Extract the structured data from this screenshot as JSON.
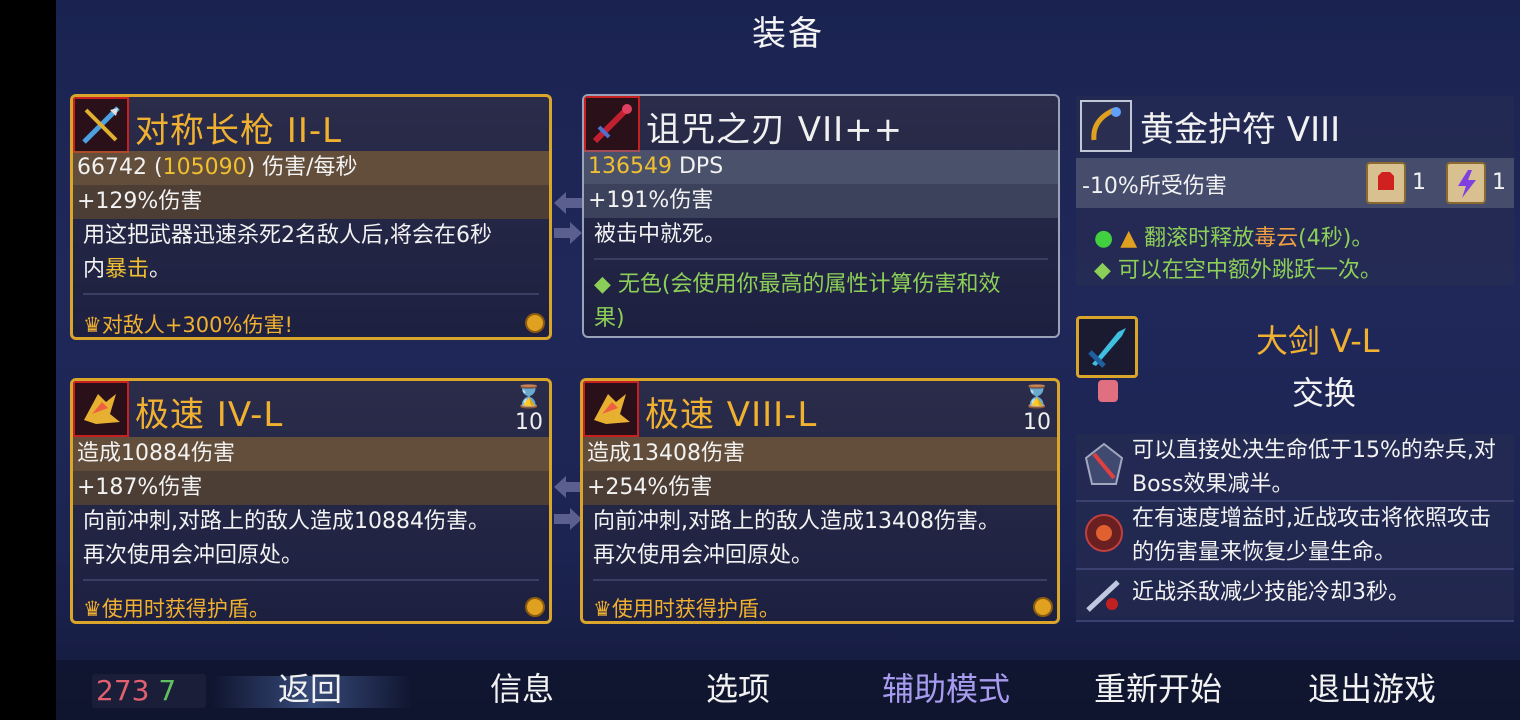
{
  "screen_title": "装备",
  "weapon1": {
    "name": "对称长枪 II-L",
    "stat_main": "66742",
    "stat_alt": "105090",
    "stat_unit": "伤害/每秒",
    "bonus": "+129%伤害",
    "desc_line1": "用这把武器迅速杀死2名敌人后,将会在6秒",
    "desc_line2a": "内",
    "desc_line2b": "暴击",
    "desc_line2c": "。",
    "perk": "对敌人+300%伤害!"
  },
  "weapon2": {
    "name": "诅咒之刃 VII++",
    "stat_main": "136549",
    "stat_unit": "DPS",
    "bonus": "+191%伤害",
    "desc": "被击中就死。",
    "affix_line1": "无色(会使用你最高的属性计算伤害和效",
    "affix_line2": "果)"
  },
  "skill1": {
    "name": "极速 IV-L",
    "cooldown": "10",
    "damage": "造成10884伤害",
    "bonus": "+187%伤害",
    "desc_line1": "向前冲刺,对路上的敌人造成10884伤害。",
    "desc_line2": "再次使用会冲回原处。",
    "perk": "使用时获得护盾。"
  },
  "skill2": {
    "name": "极速 VIII-L",
    "cooldown": "10",
    "damage": "造成13408伤害",
    "bonus": "+254%伤害",
    "desc_line1": "向前冲刺,对路上的敌人造成13408伤害。",
    "desc_line2": "再次使用会冲回原处。",
    "perk": "使用时获得护盾。"
  },
  "amulet": {
    "name": "黄金护符 VIII",
    "stat": "-10%所受伤害",
    "scroll_brutality": "1",
    "scroll_tactics": "1",
    "effect1a": "翻滚时释放",
    "effect1b": "毒云",
    "effect1c": "(4秒)。",
    "effect2": "可以在空中额外跳跃一次。"
  },
  "swap": {
    "name": "大剑 V-L",
    "action": "交换"
  },
  "mutations": [
    {
      "text": "可以直接处决生命低于15%的杂兵,对Boss效果减半。"
    },
    {
      "text": "在有速度增益时,近战攻击将依照攻击的伤害量来恢复少量生命。"
    },
    {
      "text": "近战杀敌减少技能冷却3秒。"
    }
  ],
  "counters": {
    "a": "273",
    "b": "7"
  },
  "menu": {
    "back": "返回",
    "info": "信息",
    "options": "选项",
    "assist": "辅助模式",
    "restart": "重新开始",
    "quit": "退出游戏"
  },
  "colors": {
    "gold": "#f0b030",
    "green": "#8ccf58",
    "menu_selected": "#a89cf0"
  }
}
